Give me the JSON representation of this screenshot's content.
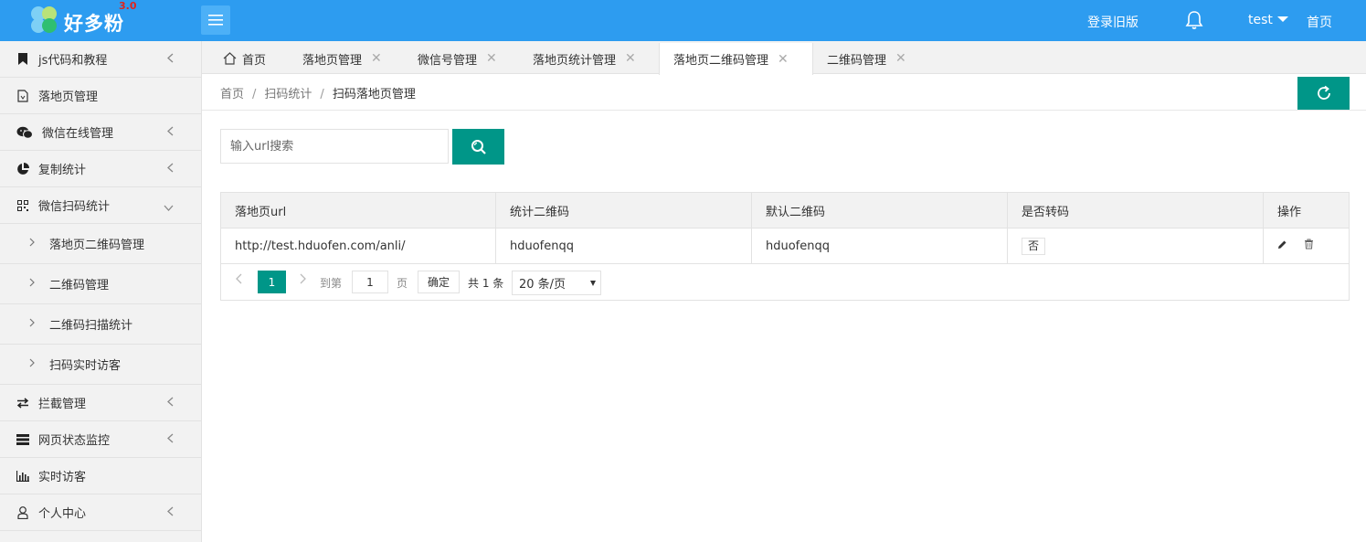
{
  "header": {
    "logo_text": "好多粉",
    "logo_version": "3.0",
    "old_version_link": "登录旧版",
    "username": "test",
    "home_link": "首页"
  },
  "sidebar": {
    "items": [
      {
        "label": "js代码和教程",
        "icon": "bookmark-icon",
        "expandable": true
      },
      {
        "label": "落地页管理",
        "icon": "document-icon",
        "expandable": false
      },
      {
        "label": "微信在线管理",
        "icon": "wechat-icon",
        "expandable": true
      },
      {
        "label": "复制统计",
        "icon": "pie-chart-icon",
        "expandable": true
      },
      {
        "label": "微信扫码统计",
        "icon": "qrcode-icon",
        "expandable": true,
        "expanded": true
      },
      {
        "label": "拦截管理",
        "icon": "swap-icon",
        "expandable": true
      },
      {
        "label": "网页状态监控",
        "icon": "server-icon",
        "expandable": true
      },
      {
        "label": "实时访客",
        "icon": "bar-chart-icon",
        "expandable": false
      },
      {
        "label": "个人中心",
        "icon": "user-icon",
        "expandable": true
      }
    ],
    "subitems": [
      {
        "label": "落地页二维码管理"
      },
      {
        "label": "二维码管理"
      },
      {
        "label": "二维码扫描统计"
      },
      {
        "label": "扫码实时访客"
      }
    ]
  },
  "tabs": [
    {
      "label": "首页",
      "closable": false
    },
    {
      "label": "落地页管理",
      "closable": true
    },
    {
      "label": "微信号管理",
      "closable": true
    },
    {
      "label": "落地页统计管理",
      "closable": true
    },
    {
      "label": "落地页二维码管理",
      "closable": true,
      "active": true
    },
    {
      "label": "二维码管理",
      "closable": true
    }
  ],
  "tab_close_glyph": "✕",
  "breadcrumb": {
    "items": [
      "首页",
      "扫码统计",
      "扫码落地页管理"
    ],
    "separator": "/"
  },
  "search": {
    "placeholder": "输入url搜索",
    "value": ""
  },
  "table": {
    "columns": [
      "落地页url",
      "统计二维码",
      "默认二维码",
      "是否转码",
      "操作"
    ],
    "rows": [
      {
        "url": "http://test.hduofen.com/anli/",
        "stat_qrcode": "hduofenqq",
        "default_qrcode": "hduofenqq",
        "transcode": "否"
      }
    ]
  },
  "pager": {
    "current_page": "1",
    "goto_label": "到第",
    "goto_value": "1",
    "page_unit": "页",
    "confirm_label": "确定",
    "total_label": "共 1 条",
    "page_size": "20 条/页"
  },
  "colors": {
    "header_bg": "#2d9cf0",
    "primary_green": "#009688",
    "logo_version": "#e0251c"
  }
}
